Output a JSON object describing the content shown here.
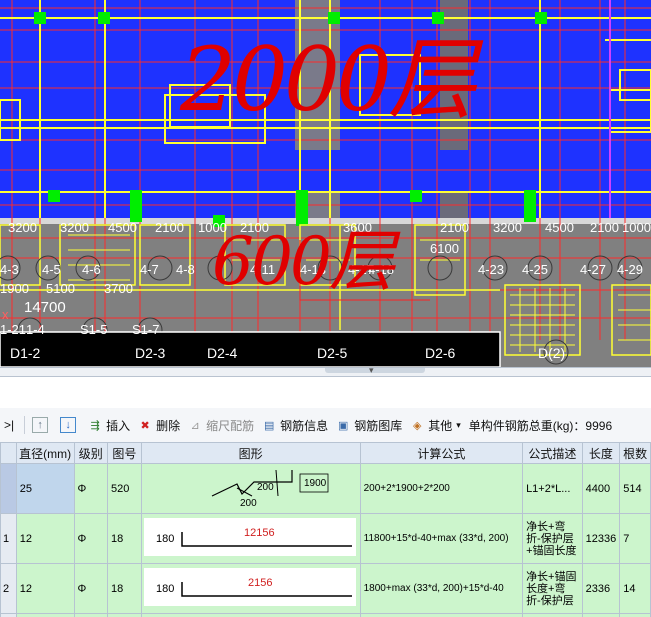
{
  "canvas": {
    "top_labels_row1": [
      "3200",
      "3200",
      "4500",
      "2100",
      "1000",
      "2100",
      "3600",
      "2100",
      "3200",
      "4500",
      "2100",
      "1000"
    ],
    "top_labels_row2": [
      "4-3",
      "4-5",
      "4-6",
      "4-7",
      "4-8",
      "4-11",
      "4-13",
      "4-17",
      "4-18",
      "4-23",
      "4-25",
      "4-27",
      "4-29"
    ],
    "small_dims": [
      "1900",
      "5100",
      "3700",
      "6100"
    ],
    "dim_14700": "14700",
    "beam_labels": [
      "1-21",
      "1-4",
      "S1-5",
      "S1-7"
    ],
    "axis_labels": [
      "D1-2",
      "D2-3",
      "D2-4",
      "D2-5",
      "D2-6",
      "D(2)"
    ],
    "annot_2000": "2000层",
    "annot_600": "600层",
    "x_mark": "x",
    "colors": {
      "blue": "#1e32ff",
      "grey": "#808080",
      "yellow": "#ffff33",
      "green": "#00ee00",
      "red": "#ff2020",
      "black": "#000000",
      "magenta": "#d040ff"
    }
  },
  "toolbar": {
    "expand": ">|",
    "up_icon": "move-up-icon",
    "down_icon": "move-down-icon",
    "insert": "插入",
    "delete": "删除",
    "scale": "缩尺配筋",
    "rebar_info": "钢筋信息",
    "rebar_lib": "钢筋图库",
    "other": "其他",
    "total_label": "单构件钢筋总重(kg)：9996"
  },
  "table": {
    "headers": [
      "直径(mm)",
      "级别",
      "图号",
      "图形",
      "计算公式",
      "公式描述",
      "长度",
      "根数"
    ],
    "rows": [
      {
        "index": "",
        "diameter": "25",
        "grade": "Φ",
        "fig_no": "520",
        "shape_dims": [
          "200",
          "200",
          "1900"
        ],
        "formula": "200+2*1900+2*200",
        "description": "L1+2*L...",
        "length": "4400",
        "count": "514"
      },
      {
        "index": "1",
        "diameter": "12",
        "grade": "Φ",
        "fig_no": "18",
        "shape_dims": [
          "180",
          "12156"
        ],
        "formula": "11800+15*d-40+max (33*d, 200)",
        "description": "净长+弯折-保护层+锚固长度",
        "length": "12336",
        "count": "7"
      },
      {
        "index": "2",
        "diameter": "12",
        "grade": "Φ",
        "fig_no": "18",
        "shape_dims": [
          "180",
          "2156"
        ],
        "formula": "1800+max (33*d, 200)+15*d-40",
        "description": "净长+锚固长度+弯折-保护层",
        "length": "2336",
        "count": "14"
      }
    ]
  }
}
